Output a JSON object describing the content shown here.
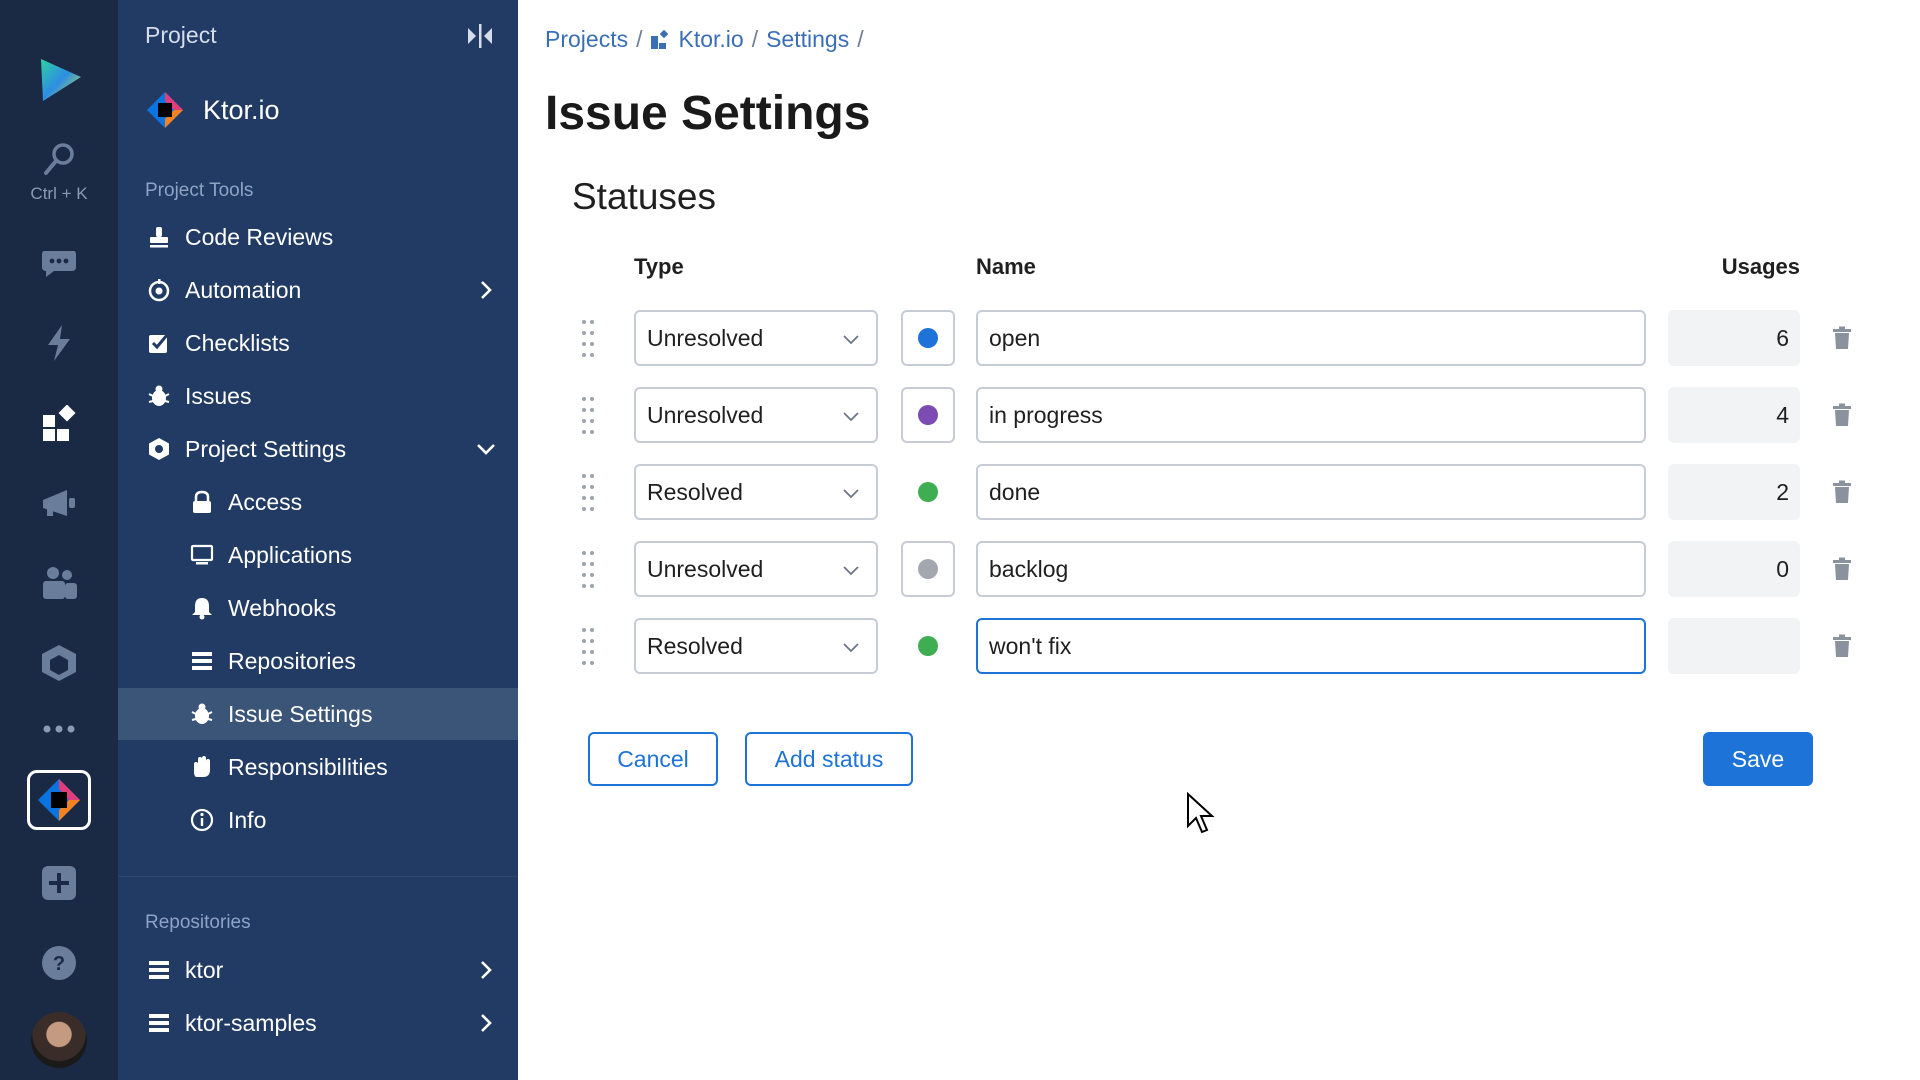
{
  "rail": {
    "search_hint": "Ctrl + K"
  },
  "sidebar": {
    "header": "Project",
    "project_name": "Ktor.io",
    "tools_heading": "Project Tools",
    "items": [
      {
        "label": "Code Reviews",
        "icon": "stamp-icon"
      },
      {
        "label": "Automation",
        "icon": "automation-icon"
      },
      {
        "label": "Checklists",
        "icon": "checklist-icon"
      },
      {
        "label": "Issues",
        "icon": "bug-icon"
      },
      {
        "label": "Project Settings",
        "icon": "settings-hex-icon"
      },
      {
        "label": "Access",
        "icon": "lock-icon"
      },
      {
        "label": "Applications",
        "icon": "monitor-icon"
      },
      {
        "label": "Webhooks",
        "icon": "bell-icon"
      },
      {
        "label": "Repositories",
        "icon": "repo-icon"
      },
      {
        "label": "Issue Settings",
        "icon": "bug-icon"
      },
      {
        "label": "Responsibilities",
        "icon": "hand-icon"
      },
      {
        "label": "Info",
        "icon": "info-icon"
      }
    ],
    "repos_heading": "Repositories",
    "repos": [
      {
        "label": "ktor"
      },
      {
        "label": "ktor-samples"
      }
    ]
  },
  "breadcrumb": {
    "items": [
      "Projects",
      "Ktor.io",
      "Settings"
    ],
    "separator": "/"
  },
  "page_title": "Issue Settings",
  "section_title": "Statuses",
  "columns": {
    "type": "Type",
    "name": "Name",
    "usages": "Usages"
  },
  "statuses": [
    {
      "type": "Unresolved",
      "color": "#1d73d8",
      "name": "open",
      "usages": "6",
      "swatch_bordered": true
    },
    {
      "type": "Unresolved",
      "color": "#7c4cb3",
      "name": "in progress",
      "usages": "4",
      "swatch_bordered": true
    },
    {
      "type": "Resolved",
      "color": "#3fad52",
      "name": "done",
      "usages": "2",
      "swatch_bordered": false
    },
    {
      "type": "Unresolved",
      "color": "#a3a7b0",
      "name": "backlog",
      "usages": "0",
      "swatch_bordered": true
    },
    {
      "type": "Resolved",
      "color": "#3fad52",
      "name": "won't fix",
      "usages": "",
      "swatch_bordered": false
    }
  ],
  "buttons": {
    "cancel": "Cancel",
    "add_status": "Add status",
    "save": "Save"
  },
  "colors": {
    "accent": "#1d73d8",
    "sidebar_bg": "#213b64",
    "rail_bg": "#1a2a45"
  }
}
